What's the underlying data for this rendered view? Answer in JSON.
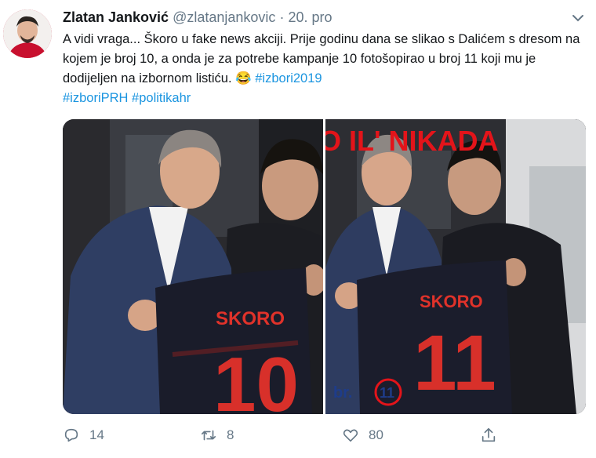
{
  "tweet": {
    "author_name": "Zlatan Janković",
    "handle": "@zlatanjankovic",
    "separator": "·",
    "date": "20. pro",
    "text_main": "A vidi vraga... Škoro u fake news akciji. Prije godinu dana se slikao s Dalićem s dresom na kojem je broj 10, a onda je za potrebe kampanje 10 fotošopirao u broj 11 koji mu je dodijeljen na izbornom listiću. 😂 ",
    "hashtag_1": "#izbori2019",
    "hashtag_2": "#izboriPRH",
    "hashtag_3": "#politikahr"
  },
  "media": {
    "left": {
      "shirt_name": "SKORO",
      "shirt_number": "10"
    },
    "right": {
      "banner": "O IL' NIKADA",
      "shirt_name": "SKORO",
      "shirt_number": "11",
      "ballot_label": "br.",
      "ballot_number": "11"
    }
  },
  "actions": {
    "reply_count": "14",
    "retweet_count": "8",
    "like_count": "80"
  },
  "colors": {
    "hashtag": "#1b95e0",
    "muted": "#657786",
    "banner_red": "#e3141a",
    "ballot_blue": "#1e3c8a"
  }
}
